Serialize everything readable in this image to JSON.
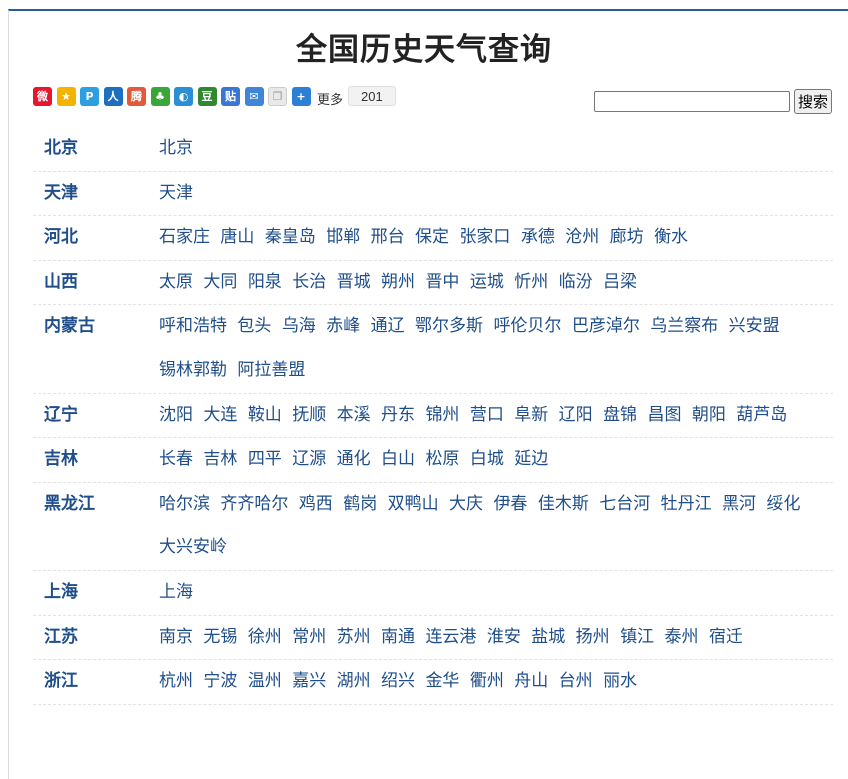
{
  "page": {
    "title": "全国历史天气查询"
  },
  "share": {
    "icons": [
      {
        "name": "weibo-icon",
        "glyph": "微",
        "color": "#e6162d"
      },
      {
        "name": "qzone-icon",
        "glyph": "★",
        "color": "#f3b400"
      },
      {
        "name": "pengyou-icon",
        "glyph": "P",
        "color": "#2c9fe0"
      },
      {
        "name": "renren-icon",
        "glyph": "人",
        "color": "#1f6fbf"
      },
      {
        "name": "tencent-weibo-icon",
        "glyph": "腾",
        "color": "#e35a3a"
      },
      {
        "name": "kaixin-icon",
        "glyph": "♣",
        "color": "#3aa63a"
      },
      {
        "name": "sohu-icon",
        "glyph": "◐",
        "color": "#2b8fd6"
      },
      {
        "name": "douban-icon",
        "glyph": "豆",
        "color": "#2f8a2f"
      },
      {
        "name": "baidu-tieba-icon",
        "glyph": "贴",
        "color": "#3b76d6"
      },
      {
        "name": "email-icon",
        "glyph": "✉",
        "color": "#3f86d8"
      },
      {
        "name": "copy-icon",
        "glyph": "❐",
        "color": "#e9e9e9"
      },
      {
        "name": "plus-icon",
        "glyph": "+",
        "color": "#2d7fd6"
      }
    ],
    "more_label": "更多",
    "count": "201"
  },
  "search": {
    "value": "",
    "button_label": "搜索"
  },
  "regions": [
    {
      "province": "北京",
      "cities": [
        "北京"
      ]
    },
    {
      "province": "天津",
      "cities": [
        "天津"
      ]
    },
    {
      "province": "河北",
      "cities": [
        "石家庄",
        "唐山",
        "秦皇岛",
        "邯郸",
        "邢台",
        "保定",
        "张家口",
        "承德",
        "沧州",
        "廊坊",
        "衡水"
      ]
    },
    {
      "province": "山西",
      "cities": [
        "太原",
        "大同",
        "阳泉",
        "长治",
        "晋城",
        "朔州",
        "晋中",
        "运城",
        "忻州",
        "临汾",
        "吕梁"
      ]
    },
    {
      "province": "内蒙古",
      "cities": [
        "呼和浩特",
        "包头",
        "乌海",
        "赤峰",
        "通辽",
        "鄂尔多斯",
        "呼伦贝尔",
        "巴彦淖尔",
        "乌兰察布",
        "兴安盟",
        "锡林郭勒",
        "阿拉善盟"
      ]
    },
    {
      "province": "辽宁",
      "cities": [
        "沈阳",
        "大连",
        "鞍山",
        "抚顺",
        "本溪",
        "丹东",
        "锦州",
        "营口",
        "阜新",
        "辽阳",
        "盘锦",
        "昌图",
        "朝阳",
        "葫芦岛"
      ]
    },
    {
      "province": "吉林",
      "cities": [
        "长春",
        "吉林",
        "四平",
        "辽源",
        "通化",
        "白山",
        "松原",
        "白城",
        "延边"
      ]
    },
    {
      "province": "黑龙江",
      "cities": [
        "哈尔滨",
        "齐齐哈尔",
        "鸡西",
        "鹤岗",
        "双鸭山",
        "大庆",
        "伊春",
        "佳木斯",
        "七台河",
        "牡丹江",
        "黑河",
        "绥化",
        "大兴安岭"
      ]
    },
    {
      "province": "上海",
      "cities": [
        "上海"
      ]
    },
    {
      "province": "江苏",
      "cities": [
        "南京",
        "无锡",
        "徐州",
        "常州",
        "苏州",
        "南通",
        "连云港",
        "淮安",
        "盐城",
        "扬州",
        "镇江",
        "泰州",
        "宿迁"
      ]
    },
    {
      "province": "浙江",
      "cities": [
        "杭州",
        "宁波",
        "温州",
        "嘉兴",
        "湖州",
        "绍兴",
        "金华",
        "衢州",
        "舟山",
        "台州",
        "丽水"
      ]
    }
  ]
}
